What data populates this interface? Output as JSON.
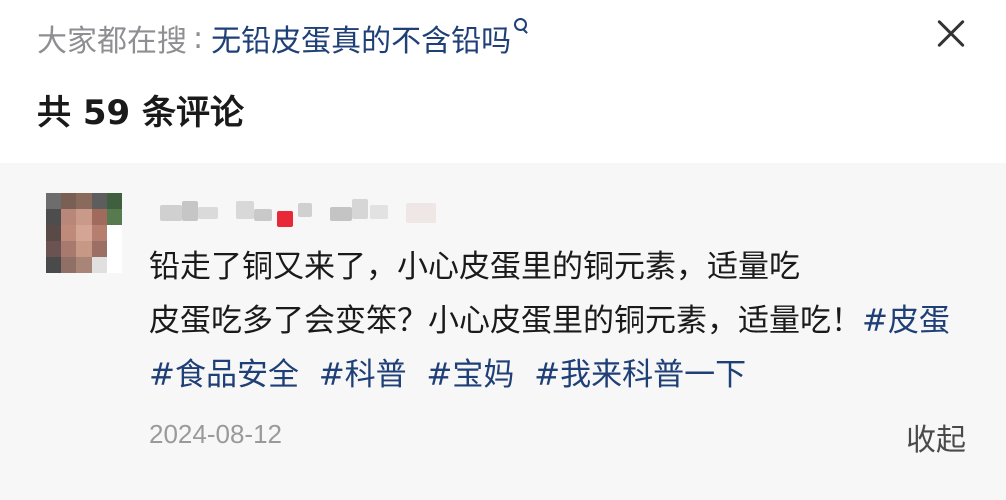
{
  "search": {
    "prefix": "大家都在搜",
    "separator": ":",
    "query": "无铅皮蛋真的不含铅吗",
    "icon": "search-icon"
  },
  "close_icon": "close-icon",
  "comments": {
    "count_label": "共 59 条评论"
  },
  "comment": {
    "username": "",
    "text_line1": "铅走了铜又来了，小心皮蛋里的铜元素，适量吃",
    "text_line2": "皮蛋吃多了会变笨？小心皮蛋里的铜元素，适量吃！",
    "tags": [
      "#皮蛋",
      "#食品安全",
      "#科普",
      "#宝妈",
      "#我来科普一下"
    ],
    "date": "2024-08-12",
    "collapse_label": "收起"
  },
  "colors": {
    "link": "#1f3f77",
    "muted": "#8e8e93",
    "comment_bg": "#f7f7f7",
    "badge": "#e82a38"
  }
}
